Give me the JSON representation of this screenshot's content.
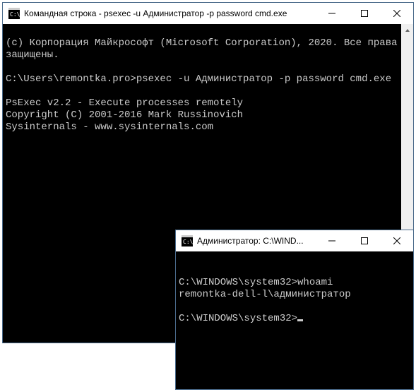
{
  "window1": {
    "title": "Командная строка - psexec  -u Администратор -p password cmd.exe",
    "lines": {
      "copyright": "(c) Корпорация Майкрософт (Microsoft Corporation), 2020. Все права защищены.",
      "blank1": "",
      "prompt_cmd": "C:\\Users\\remontka.pro>psexec -u Администратор -p password cmd.exe",
      "blank2": "",
      "psexec1": "PsExec v2.2 - Execute processes remotely",
      "psexec2": "Copyright (C) 2001-2016 Mark Russinovich",
      "psexec3": "Sysinternals - www.sysinternals.com"
    }
  },
  "window2": {
    "title": "Администратор: C:\\WIND...",
    "lines": {
      "blank0": "",
      "cmd1": "C:\\WINDOWS\\system32>whoami",
      "out1": "remontka-dell-l\\администратор",
      "blank1": "",
      "cmd2": "C:\\WINDOWS\\system32>"
    }
  }
}
